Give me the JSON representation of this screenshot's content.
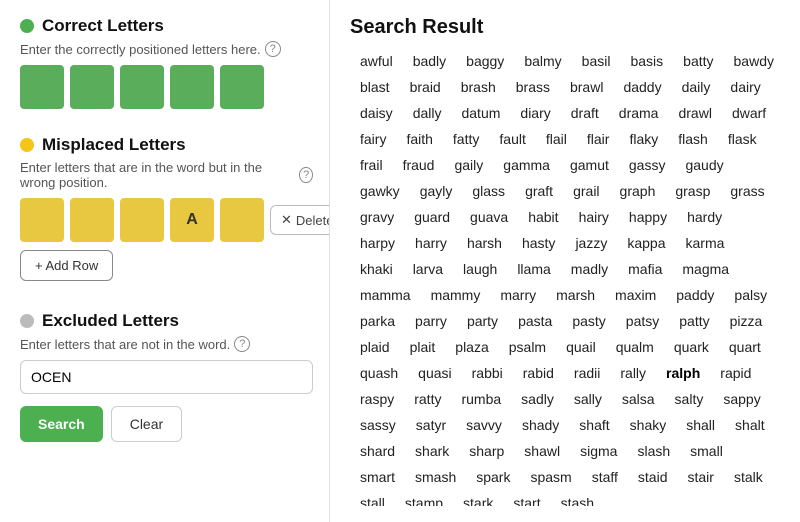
{
  "leftPanel": {
    "correctLetters": {
      "title": "Correct Letters",
      "description": "Enter the correctly positioned letters here.",
      "boxes": [
        "",
        "",
        "",
        "",
        ""
      ]
    },
    "misplacedLetters": {
      "title": "Misplaced Letters",
      "description": "Enter letters that are in the word but in the wrong position.",
      "rows": [
        {
          "letters": [
            "",
            "",
            "",
            "A",
            ""
          ],
          "deleteLabel": "Delete Row"
        }
      ],
      "addRowLabel": "+ Add Row"
    },
    "excludedLetters": {
      "title": "Excluded Letters",
      "description": "Enter letters that are not in the word.",
      "inputValue": "OCEN",
      "inputPlaceholder": ""
    },
    "buttons": {
      "search": "Search",
      "clear": "Clear"
    }
  },
  "rightPanel": {
    "title": "Search Result",
    "words": [
      "awful",
      "badly",
      "baggy",
      "balmy",
      "basil",
      "basis",
      "batty",
      "bawdy",
      "blast",
      "braid",
      "brash",
      "brass",
      "brawl",
      "daddy",
      "daily",
      "dairy",
      "daisy",
      "dally",
      "datum",
      "diary",
      "draft",
      "drama",
      "drawl",
      "dwarf",
      "fairy",
      "faith",
      "fatty",
      "fault",
      "flail",
      "flair",
      "flaky",
      "flash",
      "flask",
      "frail",
      "fraud",
      "gaily",
      "gamma",
      "gamut",
      "gassy",
      "gaudy",
      "gawky",
      "gayly",
      "glass",
      "graft",
      "grail",
      "graph",
      "grasp",
      "grass",
      "gravy",
      "guard",
      "guava",
      "habit",
      "hairy",
      "happy",
      "hardy",
      "harpy",
      "harry",
      "harsh",
      "hasty",
      "jazzy",
      "kappa",
      "karma",
      "khaki",
      "larva",
      "laugh",
      "llama",
      "madly",
      "mafia",
      "magma",
      "mamma",
      "mammy",
      "marry",
      "marsh",
      "maxim",
      "paddy",
      "palsy",
      "parka",
      "parry",
      "party",
      "pasta",
      "pasty",
      "patsy",
      "patty",
      "pizza",
      "plaid",
      "plait",
      "plaza",
      "psalm",
      "quail",
      "qualm",
      "quark",
      "quart",
      "quash",
      "quasi",
      "rabbi",
      "rabid",
      "radii",
      "rally",
      "ralph",
      "rapid",
      "raspy",
      "ratty",
      "rumba",
      "sadly",
      "sally",
      "salsa",
      "salty",
      "sappy",
      "sassy",
      "satyr",
      "savvy",
      "shady",
      "shaft",
      "shaky",
      "shall",
      "shalt",
      "shard",
      "shark",
      "sharp",
      "shawl",
      "sigma",
      "slash",
      "small",
      "smart",
      "smash",
      "spark",
      "spasm",
      "staff",
      "staid",
      "stair",
      "stalk",
      "stall",
      "stamp",
      "stark",
      "start",
      "stash"
    ],
    "highlightWord": "ralph"
  }
}
